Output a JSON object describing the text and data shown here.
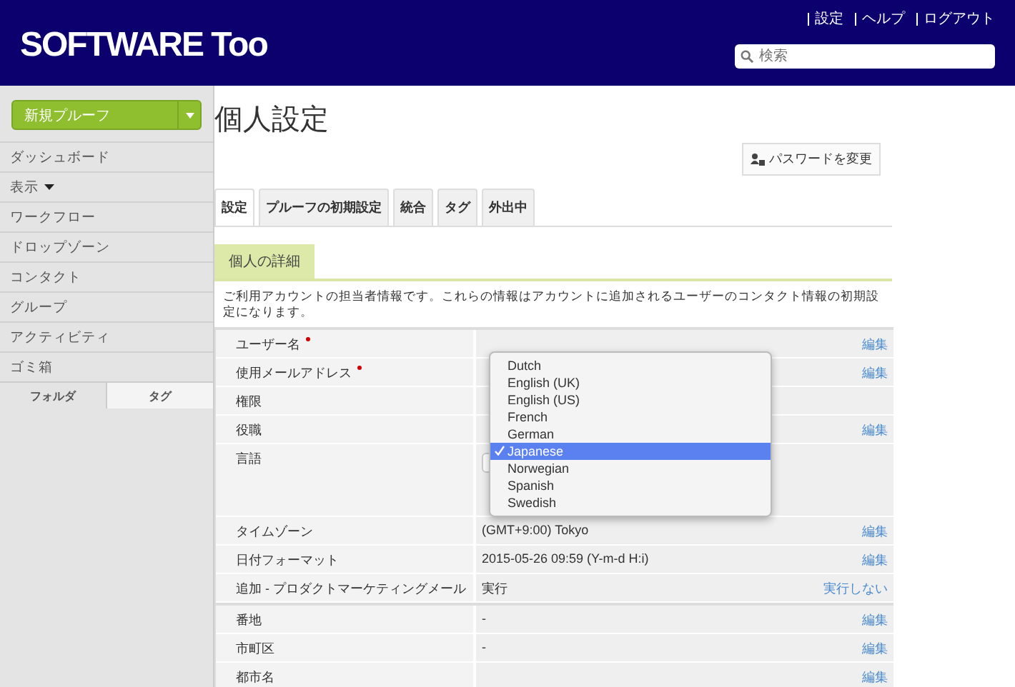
{
  "header": {
    "logo": "SOFTWARE Too",
    "links": [
      "設定",
      "ヘルプ",
      "ログアウト"
    ],
    "search": {
      "placeholder": "検索"
    }
  },
  "sidebar": {
    "new_button": "新規プルーフ",
    "items": [
      {
        "label": "ダッシュボード",
        "dropdown": false
      },
      {
        "label": "表示",
        "dropdown": true
      },
      {
        "label": "ワークフロー",
        "dropdown": false
      },
      {
        "label": "ドロップゾーン",
        "dropdown": false
      },
      {
        "label": "コンタクト",
        "dropdown": false
      },
      {
        "label": "グループ",
        "dropdown": false
      },
      {
        "label": "アクティビティ",
        "dropdown": false
      },
      {
        "label": "ゴミ箱",
        "dropdown": false
      }
    ],
    "tabs": [
      {
        "label": "フォルダ",
        "selected": true
      },
      {
        "label": "タグ",
        "selected": false
      }
    ]
  },
  "page": {
    "title": "個人設定",
    "password_button": "パスワードを変更",
    "tabs": [
      {
        "label": "設定",
        "selected": true
      },
      {
        "label": "プルーフの初期設定",
        "selected": false
      },
      {
        "label": "統合",
        "selected": false
      },
      {
        "label": "タグ",
        "selected": false
      },
      {
        "label": "外出中",
        "selected": false
      }
    ],
    "section": "個人の詳細",
    "description": "ご利用アカウントの担当者情報です。これらの情報はアカウントに追加されるユーザーのコンタクト情報の初期設定になります。",
    "groups": [
      [
        {
          "kind": "text",
          "label": "ユーザー名",
          "required": true,
          "action": "編集"
        },
        {
          "kind": "text",
          "label": "使用メールアドレス",
          "required": true,
          "action": "編集"
        },
        {
          "kind": "text",
          "label": "権限",
          "required": false
        },
        {
          "kind": "text",
          "label": "役職",
          "required": false,
          "action": "編集"
        },
        {
          "kind": "select",
          "label": "言語",
          "required": false
        },
        {
          "kind": "text",
          "label": "タイムゾーン",
          "required": false,
          "value": "(GMT+9:00) Tokyo",
          "action": "編集"
        },
        {
          "kind": "text",
          "label": "日付フォーマット",
          "required": false,
          "value": "2015-05-26 09:59 (Y-m-d H:i)",
          "action": "編集"
        },
        {
          "kind": "text",
          "label": "追加 - プロダクトマーケティングメール",
          "required": false,
          "value": "実行",
          "action": "実行しない"
        }
      ],
      [
        {
          "kind": "text",
          "label": "番地",
          "required": false,
          "value": "-",
          "action": "編集"
        },
        {
          "kind": "text",
          "label": "市町区",
          "required": false,
          "value": "-",
          "action": "編集"
        },
        {
          "kind": "text",
          "label": "都市名",
          "required": false,
          "action": "編集"
        }
      ]
    ],
    "language_menu": [
      {
        "label": "Dutch",
        "selected": false
      },
      {
        "label": "English (UK)",
        "selected": false
      },
      {
        "label": "English (US)",
        "selected": false
      },
      {
        "label": "French",
        "selected": false
      },
      {
        "label": "German",
        "selected": false
      },
      {
        "label": "Japanese",
        "selected": true
      },
      {
        "label": "Norwegian",
        "selected": false
      },
      {
        "label": "Spanish",
        "selected": false
      },
      {
        "label": "Swedish",
        "selected": false
      }
    ]
  }
}
